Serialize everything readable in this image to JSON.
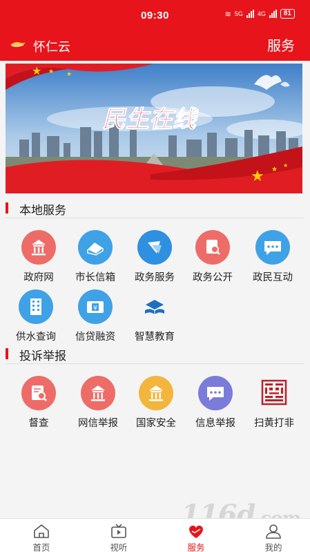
{
  "status_bar": {
    "time": "09:30",
    "network_5g": "5G",
    "network_4g": "4G",
    "battery": "81"
  },
  "app_bar": {
    "app_name": "怀仁云",
    "page_title": "服务"
  },
  "banner": {
    "headline": "民生在线"
  },
  "sections": [
    {
      "title": "本地服务",
      "items": [
        {
          "label": "政府网",
          "icon": "government-building-icon",
          "color": "#ee6c68"
        },
        {
          "label": "市长信箱",
          "icon": "mailbox-icon",
          "color": "#3fa1e6"
        },
        {
          "label": "政务服务",
          "icon": "service-icon",
          "color": "#2f8fe0"
        },
        {
          "label": "政务公开",
          "icon": "document-search-icon",
          "color": "#ee6c68"
        },
        {
          "label": "政民互动",
          "icon": "chat-icon",
          "color": "#3fa1e6"
        },
        {
          "label": "供水查询",
          "icon": "building-icon",
          "color": "#3fa1e6"
        },
        {
          "label": "信贷融资",
          "icon": "finance-icon",
          "color": "#3fa1e6"
        },
        {
          "label": "智慧教育",
          "icon": "education-icon",
          "color": "#1e6fc0"
        }
      ]
    },
    {
      "title": "投诉举报",
      "items": [
        {
          "label": "督查",
          "icon": "inspection-icon",
          "color": "#ee6c68"
        },
        {
          "label": "网信举报",
          "icon": "government-building-icon",
          "color": "#ee6c68"
        },
        {
          "label": "国家安全",
          "icon": "government-building-icon",
          "color": "#f3b53c"
        },
        {
          "label": "信息举报",
          "icon": "chat-icon",
          "color": "#7b7bd9"
        },
        {
          "label": "扫黄打非",
          "icon": "seal-icon",
          "color": "#c21f25"
        }
      ]
    }
  ],
  "tabs": [
    {
      "label": "首页",
      "icon": "home-icon"
    },
    {
      "label": "视听",
      "icon": "tv-icon"
    },
    {
      "label": "服务",
      "icon": "heart-icon",
      "active": true
    },
    {
      "label": "我的",
      "icon": "user-icon"
    }
  ],
  "watermark": {
    "text": "116d",
    "suffix": ".com"
  },
  "colors": {
    "brand": "#e8141b",
    "background": "#f4f4f4"
  }
}
